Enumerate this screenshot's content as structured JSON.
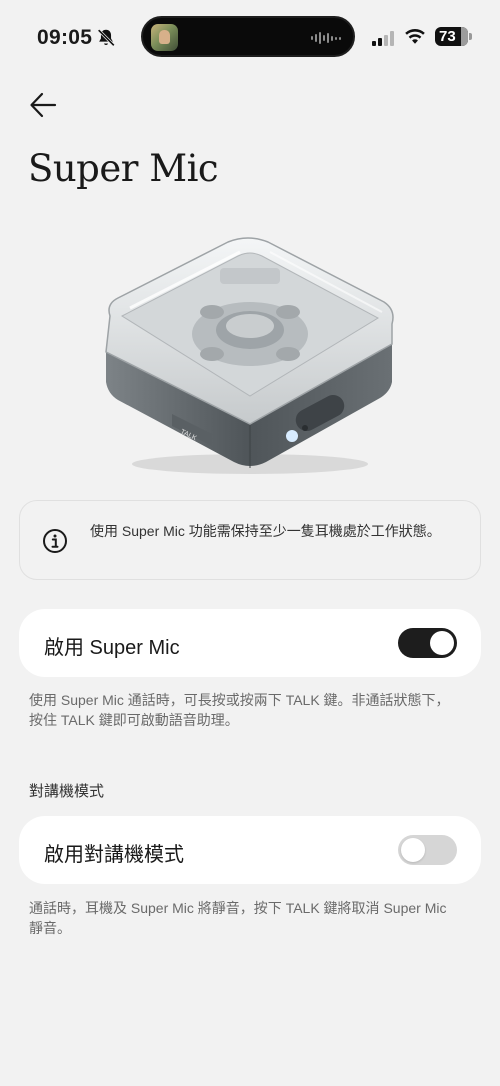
{
  "status_bar": {
    "time": "09:05",
    "battery": "73"
  },
  "page": {
    "title": "Super Mic"
  },
  "info_card": {
    "icon": "info-icon",
    "text": "使用 Super Mic 功能需保持至少一隻耳機處於工作狀態。"
  },
  "super_mic_row": {
    "label": "啟用 Super Mic",
    "toggle_on": true,
    "description": "使用 Super Mic 通話時，可長按或按兩下 TALK 鍵。非通話狀態下，按住 TALK 鍵即可啟動語音助理。"
  },
  "walkie_section": {
    "title": "對講機模式",
    "row_label": "啟用對講機模式",
    "toggle_on": false,
    "description": "通話時，耳機及 Super Mic 將靜音，按下 TALK 鍵將取消 Super Mic 靜音。"
  },
  "product_image": {
    "button_text": "TALK"
  },
  "colors": {
    "background": "#f2f2f2",
    "card": "#ffffff",
    "toggle_on": "#1d1d1d",
    "toggle_off": "#d6d6d6"
  }
}
